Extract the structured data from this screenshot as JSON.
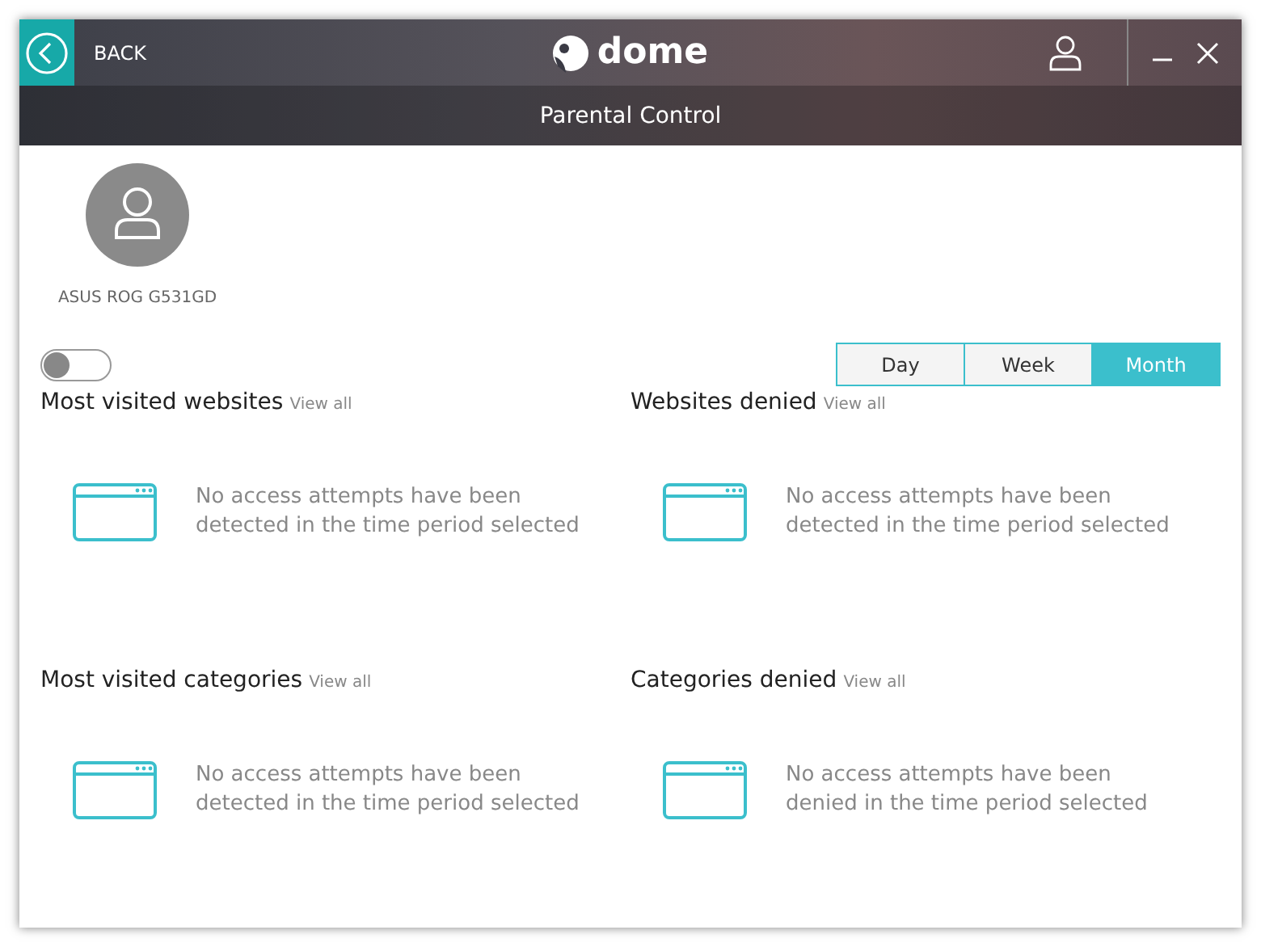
{
  "header": {
    "back_label": "BACK",
    "logo_text": "dome"
  },
  "title": "Parental Control",
  "device": {
    "name": "ASUS ROG G531GD"
  },
  "toggle": {
    "on": false
  },
  "periods": [
    {
      "label": "Day",
      "selected": false
    },
    {
      "label": "Week",
      "selected": false
    },
    {
      "label": "Month",
      "selected": true
    }
  ],
  "panels": [
    {
      "title": "Most visited websites",
      "link": "View all",
      "message": "No access attempts have been detected in the time period selected"
    },
    {
      "title": "Websites denied",
      "link": "View all",
      "message": "No access attempts have been detected in the time period selected"
    },
    {
      "title": "Most visited categories",
      "link": "View all",
      "message": "No access attempts have been detected in the time period selected"
    },
    {
      "title": "Categories denied",
      "link": "View all",
      "message": "No access attempts have been denied in the time period selected"
    }
  ]
}
